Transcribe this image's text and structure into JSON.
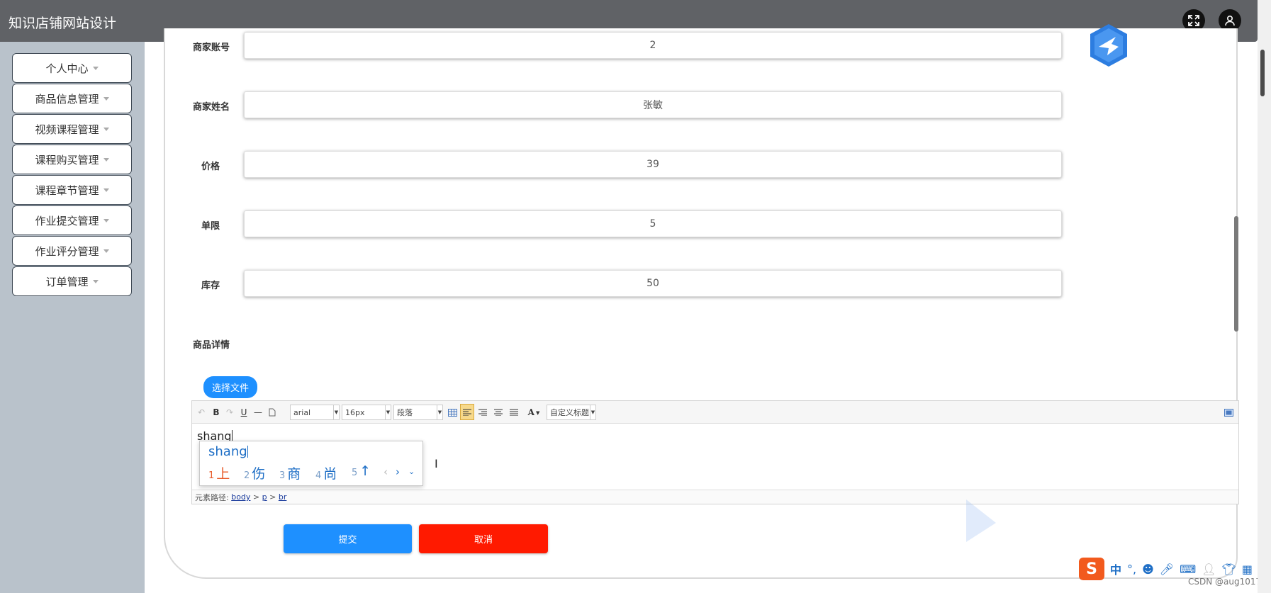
{
  "app": {
    "title": "知识店铺网站设计"
  },
  "header": {
    "fullscreen_icon": "fullscreen-icon",
    "user_icon": "user-avatar-icon"
  },
  "sidebar": {
    "items": [
      {
        "label": "个人中心"
      },
      {
        "label": "商品信息管理"
      },
      {
        "label": "视频课程管理"
      },
      {
        "label": "课程购买管理"
      },
      {
        "label": "课程章节管理"
      },
      {
        "label": "作业提交管理"
      },
      {
        "label": "作业评分管理"
      },
      {
        "label": "订单管理"
      }
    ]
  },
  "form": {
    "fields": [
      {
        "label": "商家账号",
        "value": "2"
      },
      {
        "label": "商家姓名",
        "value": "张敏"
      },
      {
        "label": "价格",
        "value": "39"
      },
      {
        "label": "单限",
        "value": "5"
      },
      {
        "label": "库存",
        "value": "50"
      }
    ],
    "details_label": "商品详情",
    "upload_button": "选择文件",
    "submit_button": "提交",
    "cancel_button": "取消"
  },
  "editor": {
    "font_family": "arial",
    "font_size": "16px",
    "paragraph": "段落",
    "custom_title": "自定义标题",
    "content": "shang",
    "path_label": "元素路径:",
    "path": [
      "body",
      "p",
      "br"
    ]
  },
  "ime": {
    "input": "shang",
    "candidates": [
      {
        "n": "1",
        "text": "上"
      },
      {
        "n": "2",
        "text": "伤"
      },
      {
        "n": "3",
        "text": "商"
      },
      {
        "n": "4",
        "text": "尚"
      },
      {
        "n": "5",
        "text": "↑"
      }
    ],
    "tray_lang": "中"
  },
  "watermark": "CSDN @aug1017",
  "colors": {
    "topbar": "#606266",
    "sidebar": "#b9c2cb",
    "primary": "#1e90ff",
    "danger": "#ff1a00"
  }
}
